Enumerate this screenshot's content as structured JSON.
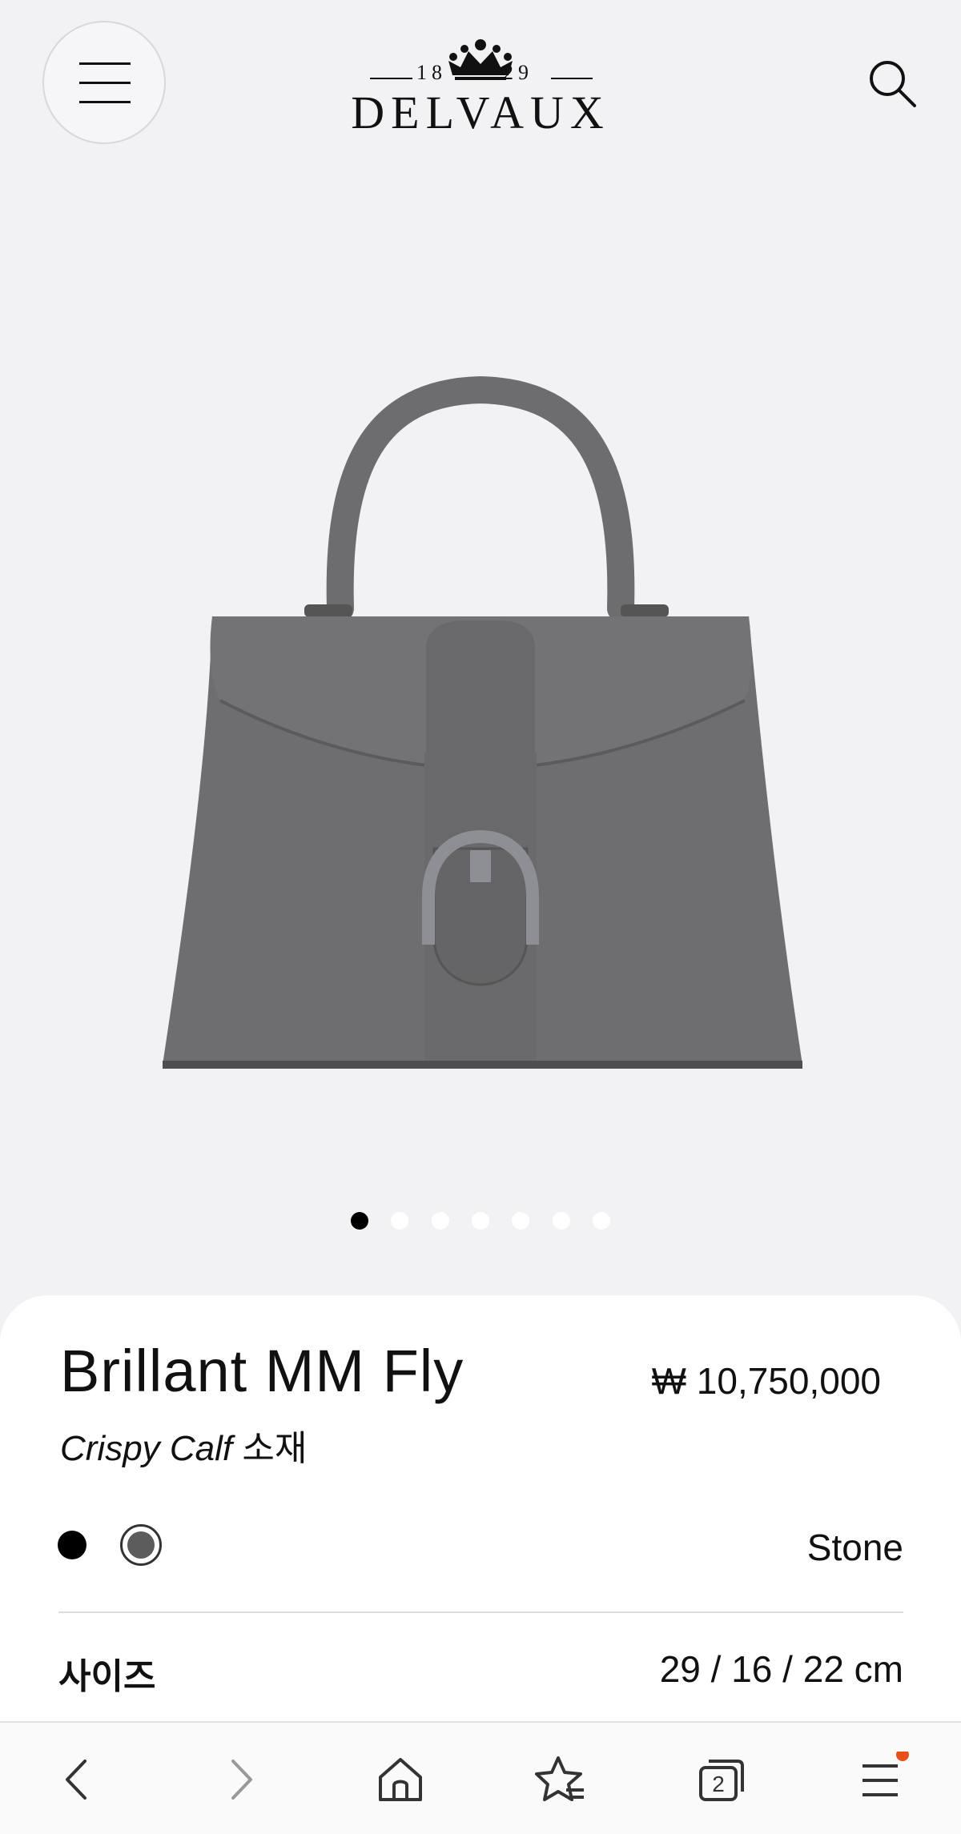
{
  "header": {
    "brand": "DELVAUX",
    "year_left": "18",
    "year_right": "29",
    "menu_icon": "hamburger-icon",
    "search_icon": "search-icon"
  },
  "gallery": {
    "image_alt": "grey-handbag-image",
    "slide_count": 7,
    "active_slide": 1
  },
  "product": {
    "name": "Brillant MM Fly",
    "price": "₩ 10,750,000",
    "material_italic": "Crispy Calf",
    "material_suffix": " 소재",
    "colors": [
      {
        "name": "Black",
        "hex": "#000000"
      },
      {
        "name": "Stone",
        "hex": "#5c5c5c"
      }
    ],
    "selected_color": "Stone",
    "size_label": "사이즈",
    "size_value": "29 / 16 / 22 cm"
  },
  "browser_toolbar": {
    "back_icon": "back-arrow-icon",
    "forward_icon": "forward-arrow-icon",
    "home_icon": "home-icon",
    "bookmarks_icon": "star-list-icon",
    "tabs_count": "2",
    "menu_icon": "menu-icon",
    "notification_dot_color": "#e8501a"
  }
}
